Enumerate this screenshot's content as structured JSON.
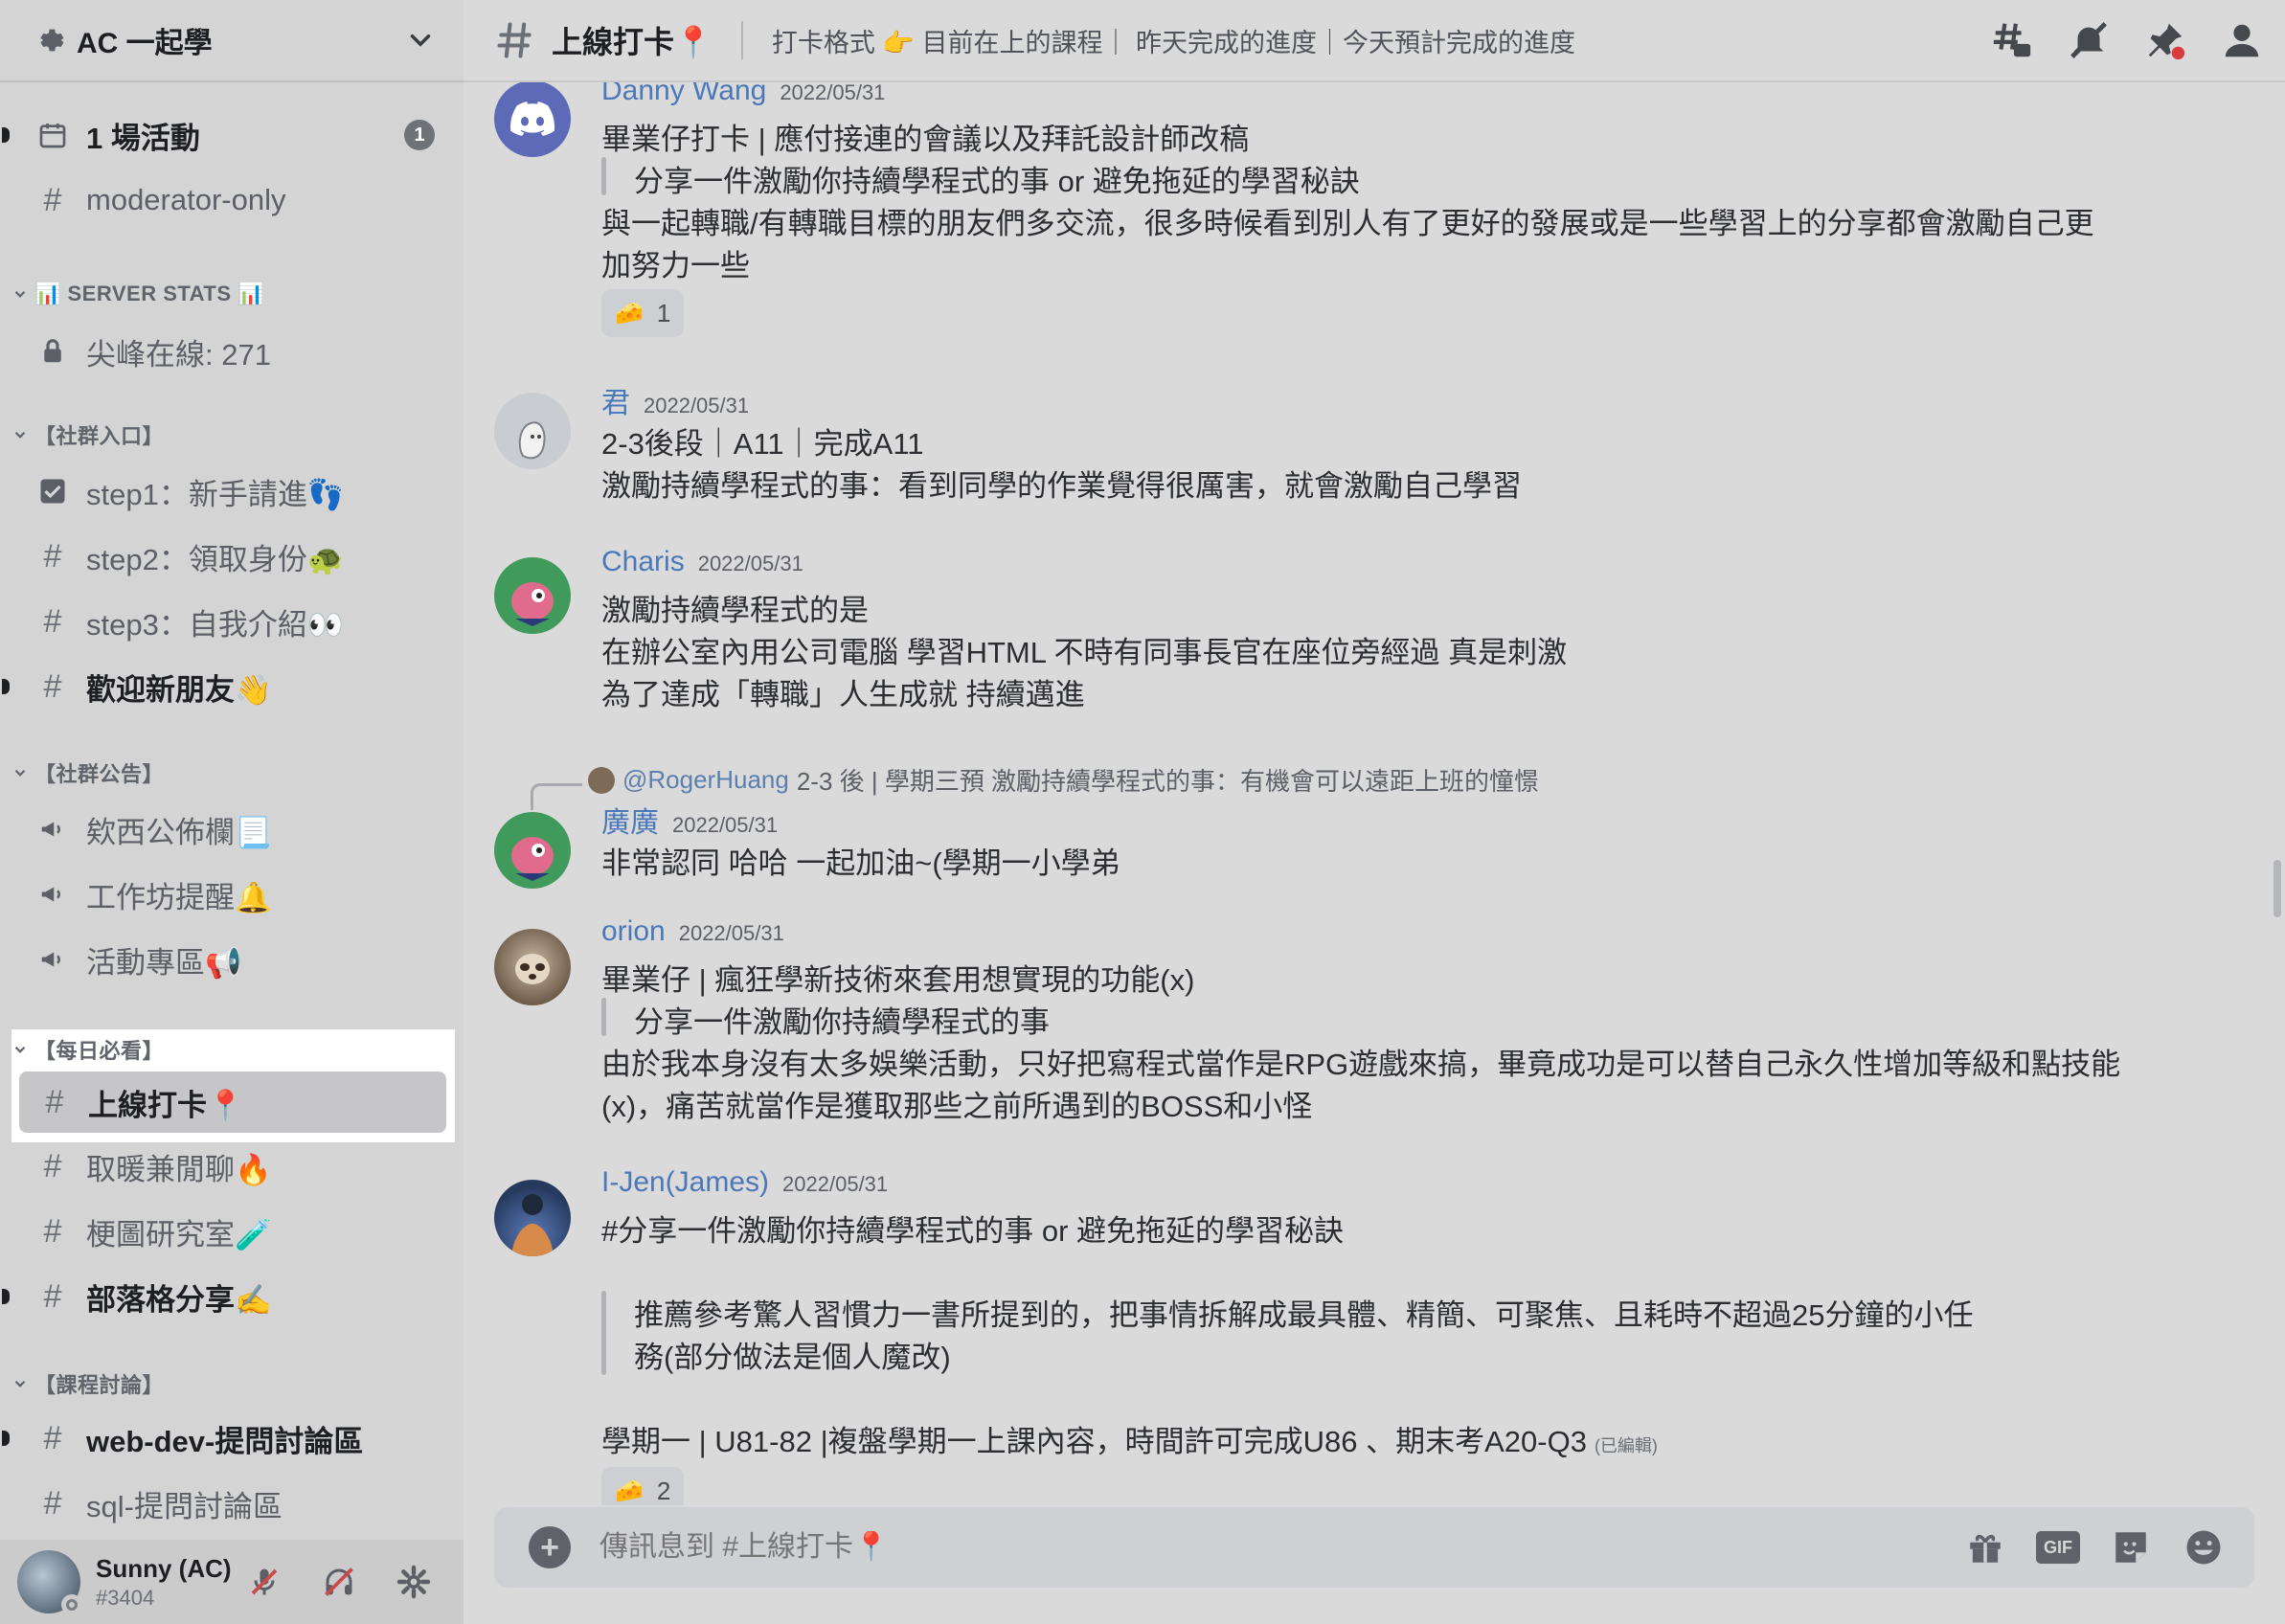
{
  "server": {
    "name": "AC 一起學"
  },
  "sidebar": {
    "items": [
      {
        "label": "1 場活動",
        "badge": "1"
      },
      {
        "label": "moderator-only"
      },
      {
        "category": "📊 SERVER STATS 📊"
      },
      {
        "label": "尖峰在線: 271"
      },
      {
        "category": "【社群入口】"
      },
      {
        "label": "step1：新手請進👣"
      },
      {
        "label": "step2：領取身份🐢"
      },
      {
        "label": "step3：自我介紹👀"
      },
      {
        "label": "歡迎新朋友👋"
      },
      {
        "category": "【社群公告】"
      },
      {
        "label": "欸西公佈欄📃"
      },
      {
        "label": "工作坊提醒🔔"
      },
      {
        "label": "活動專區📢"
      },
      {
        "category": "【每日必看】"
      },
      {
        "label": "上線打卡📍"
      },
      {
        "label": "取暖兼閒聊🔥"
      },
      {
        "label": "梗圖研究室🧪"
      },
      {
        "label": "部落格分享✍️"
      },
      {
        "category": "【課程討論】"
      },
      {
        "label": "web-dev-提問討論區"
      },
      {
        "label": "sql-提問討論區"
      }
    ]
  },
  "user": {
    "name": "Sunny (AC)",
    "tag": "#3404"
  },
  "header": {
    "channel": "上線打卡📍",
    "topic": "打卡格式 👉 目前在上的課程｜ 昨天完成的進度｜今天預計完成的進度"
  },
  "messages": [
    {
      "author": "Danny Wang",
      "date": "2022/05/31",
      "color": "#4a78b8",
      "line1": "畢業仔打卡 | 應付接連的會議以及拜託設計師改稿",
      "quote": "分享一件激勵你持續學程式的事 or 避免拖延的學習秘訣",
      "line2": "與一起轉職/有轉職目標的朋友們多交流，很多時候看到別人有了更好的發展或是一些學習上的分享都會激勵自己更",
      "line3": "加努力一些",
      "reaction_emoji": "🧀",
      "reaction_count": "1"
    },
    {
      "author": "君",
      "date": "2022/05/31",
      "color": "#4a78b8",
      "line1": "2-3後段｜A11｜完成A11",
      "line2": "激勵持續學程式的事：看到同學的作業覺得很厲害，就會激勵自己學習"
    },
    {
      "author": "Charis",
      "date": "2022/05/31",
      "color": "#4a78b8",
      "line1": "激勵持續學程式的是",
      "line2": "在辦公室內用公司電腦 學習HTML 不時有同事長官在座位旁經過 真是刺激",
      "line3": "為了達成「轉職」人生成就 持續邁進"
    },
    {
      "reply_mention": "@RogerHuang",
      "reply_text": "2-3 後 | 學期三預  激勵持續學程式的事：有機會可以遠距上班的憧憬",
      "author": "廣廣",
      "date": "2022/05/31",
      "color": "#4a78b8",
      "line1": "非常認同 哈哈 一起加油~(學期一小學弟"
    },
    {
      "author": "orion",
      "date": "2022/05/31",
      "color": "#4a78b8",
      "line1": "畢業仔 | 瘋狂學新技術來套用想實現的功能(x)",
      "quote": "分享一件激勵你持續學程式的事",
      "line2": "由於我本身沒有太多娛樂活動，只好把寫程式當作是RPG遊戲來搞，畢竟成功是可以替自己永久性增加等級和點技能",
      "line3": "(x)，痛苦就當作是獲取那些之前所遇到的BOSS和小怪"
    },
    {
      "author": "I-Jen(James)",
      "date": "2022/05/31",
      "color": "#4a78b8",
      "line1": "#分享一件激勵你持續學程式的事 or 避免拖延的學習秘訣",
      "quote1": "推薦參考驚人習慣力一書所提到的，把事情拆解成最具體、精簡、可聚焦、且耗時不超過25分鐘的小任",
      "quote2": "務(部分做法是個人魔改)",
      "line2": "學期一 | U81-82 |複盤學期一上課內容，時間許可完成U86 、期末考A20-Q3",
      "edited": "(已編輯)",
      "reaction_emoji": "🧀",
      "reaction_count": "2"
    }
  ],
  "composer": {
    "placeholder": "傳訊息到 #上線打卡📍"
  },
  "icons": {
    "topbar": [
      "threads-icon",
      "mute-bell-icon",
      "pin-icon",
      "members-icon"
    ],
    "composer": [
      "gift-icon",
      "gif-icon",
      "sticker-icon",
      "emoji-icon"
    ]
  },
  "gif_label": "GIF"
}
